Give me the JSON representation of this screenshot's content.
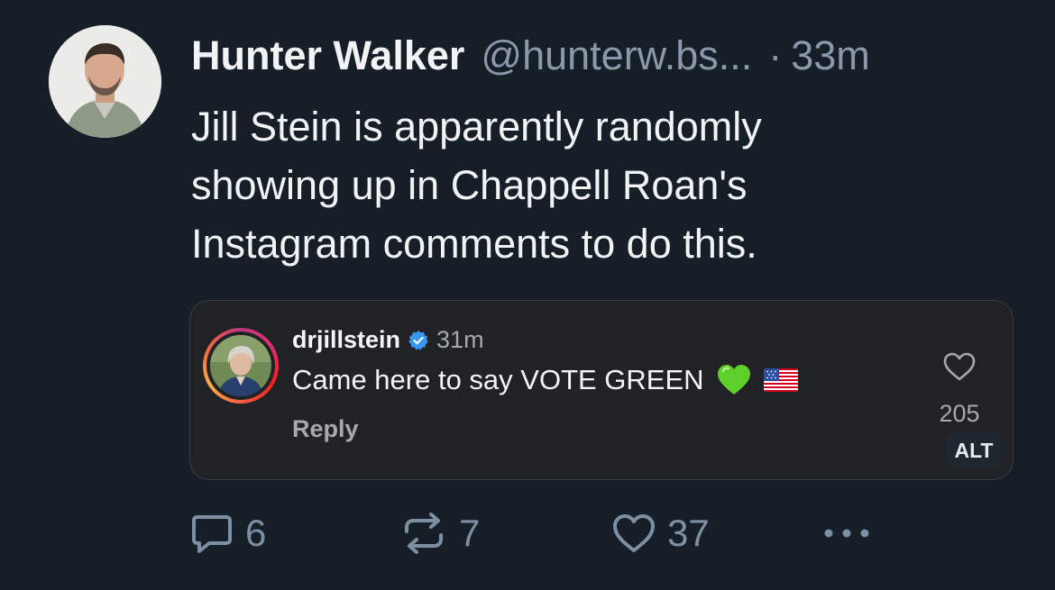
{
  "post": {
    "author_name": "Hunter Walker",
    "author_handle": "@hunterw.bs...",
    "separator": "·",
    "time": "33m",
    "text": "Jill Stein is apparently randomly\nshowing up in Chappell Roan's\nInstagram comments to do this."
  },
  "embed": {
    "commenter": "drjillstein",
    "verified_icon": "verified-badge-icon",
    "time": "31m",
    "text": "Came here to say VOTE GREEN",
    "emojis": [
      "green-heart",
      "us-flag"
    ],
    "reply_label": "Reply",
    "like_count": "205",
    "alt_label": "ALT"
  },
  "actions": {
    "reply_count": "6",
    "repost_count": "7",
    "like_count": "37",
    "more_icon": "ellipsis-icon"
  },
  "colors": {
    "background": "#161e27",
    "text": "#f1f3f5",
    "muted": "#8b98a9",
    "action": "#7f8fa3",
    "embed_bg": "#212225",
    "verified": "#3897f0"
  }
}
